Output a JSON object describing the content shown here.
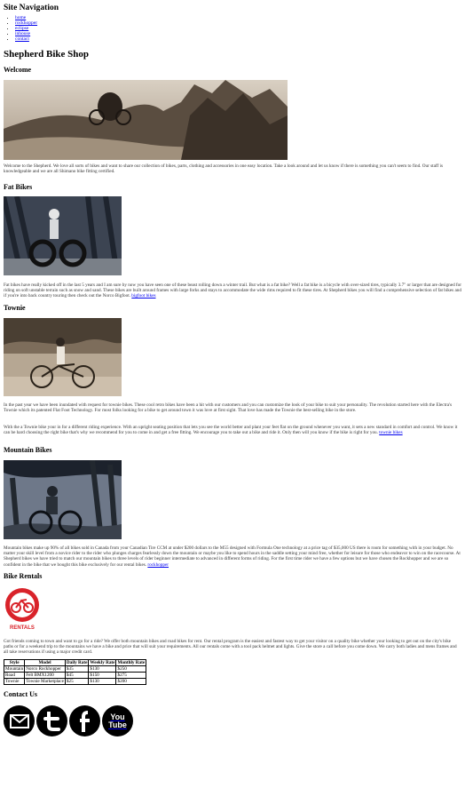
{
  "nav": {
    "heading": "Site Navigation",
    "links": [
      "home",
      "rockhopper",
      "eclipse",
      "inhouse",
      "contact"
    ]
  },
  "site_title": "Shepherd Bike Shop",
  "welcome": {
    "heading": "Welcome",
    "text": "Welcome to the Shepherd. We love all sorts of bikes and want to share our collection of bikes, parts, clothing and accessories in one easy location. Take a look around and let us know if there is something you can't seem to find. Our staff is knowledgeable and we are all Shimano bike fitting certified."
  },
  "fat_bikes": {
    "heading": "Fat Bikes",
    "text": "Fat bikes have really kicked off in the last 5 years and I am sure by now you have seen one of these beast rolling down a winter trail. But what is a fat bike? Well a fat bike is a bicycle with over-sized tires, typically 3.7\" or larger that are designed for riding on soft unstable terrain such as snow and sand. These bikes are built around frames with large forks and stays to accommodate the wide rims required to fit these tires. At Shepherd bikes you will find a comprehensive selection of fat bikes and if you're into back country touring then check out the Norco Bigfoot.",
    "link": "bigfoot bikes"
  },
  "townie": {
    "heading": "Townie",
    "text1": "In the past year we have been inundated with request for townie bikes. These cool retro bikes have been a hit with our customers and you can customize the look of your bike to suit your personality. The revolution started here with the Electra's Townie which its patented Flat Foot Technology. For most folks looking for a bike to get around town it was love at first sight. That love has made the Townie the best-selling bike in the store.",
    "text2": "With the a Townie bike your in for a different riding experience. With an upright seating position that lets you see the world better and plant your feet flat on the ground whenever you want, it sets a new standard in comfort and control. We know it can be hard choosing the right bike that's why we recommend for you to come in and get a free fitting. We encourage you to take out a bike and ride it. Only then will you know if the bike is right for you.",
    "link": "townie bikes"
  },
  "mountain_bikes": {
    "heading": "Mountain Bikes",
    "text": "Mountain bikes make up 90% of all bikes sold in Canada from your Canadian Tire CCM at under $200 dollars to the M55 designed with Formula One technology at a price tag of $35,000 US there is room for something with in your budget. No matter your skill level from a novice rider to the rider who plunges charges fearlessly down the mountain or maybe you like to spend hours in the saddle setting your mind free, whether for leisure for those who endeavor to win on the racecourse. At Shepherd bikes we have tried to match our mountain bikes to three levels of rider beginner intermediate to advanced in different forms of riding. For the first time rider we have a few options but we have chosen the Rockhopper and we are so confident in the bike that we bought this bike exclusively for our rental bikes.",
    "link": "rockhopper"
  },
  "rentals": {
    "heading": "Bike Rentals",
    "logo_text": "RENTALS",
    "text": "Got friends coming to town and want to go for a ride? We offer both mountain bikes and road bikes for rent. Our rental program is the easiest and fastest way to get your visitor on a quality bike whether your looking to get out on the city's bike paths or for a weekend trip to the mountains we have a bike and price that will suit your requirements. All our rentals come with a tool pack helmet and lights. Give the store a call before you come down. We carry both ladies and mens frames and all take reservations if using a major credit card.",
    "table": {
      "headers": [
        "Style",
        "Model",
        "Daily Rate",
        "Weekly Rate",
        "Monthly Rate"
      ],
      "rows": [
        [
          "Mountain",
          "Norco Rockhopper",
          "$35",
          "$130",
          "$250"
        ],
        [
          "Road",
          "Felt BMX1200",
          "$45",
          "$150",
          "$275"
        ],
        [
          "Townie",
          "Townie Marketplace",
          "$25",
          "$130",
          "$200"
        ]
      ]
    }
  },
  "contact": {
    "heading": "Contact Us",
    "icons": [
      "mail-icon",
      "twitter-icon",
      "facebook-icon",
      "youtube-icon"
    ],
    "youtube_text": "You Tube"
  },
  "colors": {
    "link": "#0000ee",
    "rentals_red": "#d9232a"
  }
}
